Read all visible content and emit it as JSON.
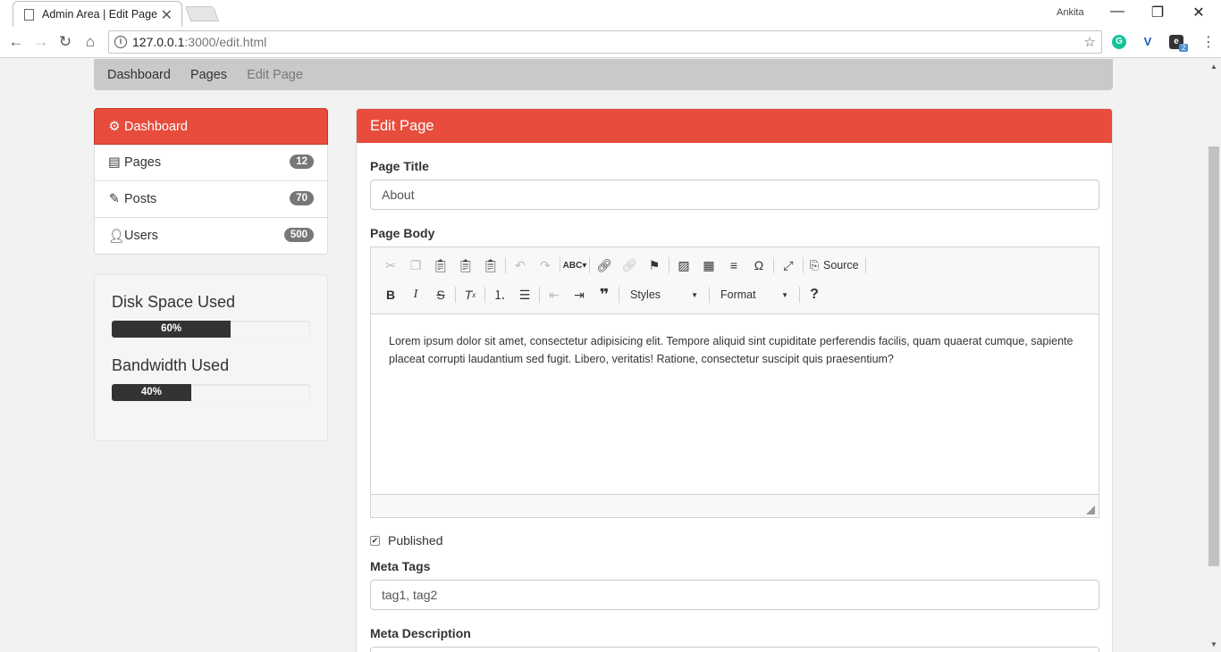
{
  "browser": {
    "tab_title": "Admin Area | Edit Page",
    "tab_close": "✕",
    "user_name": "Ankita",
    "url_host": "127.0.0.1",
    "url_path": ":3000/edit.html",
    "ext_badge": "2"
  },
  "breadcrumb": {
    "items": [
      "Dashboard",
      "Pages"
    ],
    "active": "Edit Page"
  },
  "sidebar": {
    "items": [
      {
        "label": "Dashboard",
        "icon": "gear-icon"
      },
      {
        "label": "Pages",
        "icon": "list-icon",
        "badge": "12"
      },
      {
        "label": "Posts",
        "icon": "pencil-icon",
        "badge": "70"
      },
      {
        "label": "Users",
        "icon": "user-icon",
        "badge": "500"
      }
    ]
  },
  "stats": {
    "disk": {
      "label": "Disk Space Used",
      "value": "60%",
      "percent": 60
    },
    "bandwidth": {
      "label": "Bandwidth Used",
      "value": "40%",
      "percent": 40
    }
  },
  "panel": {
    "title": "Edit Page",
    "page_title_label": "Page Title",
    "page_title_value": "About",
    "page_body_label": "Page Body",
    "body_text": "Lorem ipsum dolor sit amet, consectetur adipisicing elit. Tempore aliquid sint cupiditate perferendis facilis, quam quaerat cumque, sapiente placeat corrupti laudantium sed fugit. Libero, veritatis! Ratione, consectetur suscipit quis praesentium?",
    "published_label": "Published",
    "published_checked": true,
    "meta_tags_label": "Meta Tags",
    "meta_tags_value": "tag1, tag2",
    "meta_desc_label": "Meta Description"
  },
  "editor": {
    "source_label": "Source",
    "styles_label": "Styles",
    "format_label": "Format"
  },
  "colors": {
    "accent": "#e74c3c",
    "progress": "#333333",
    "badge": "#777777"
  }
}
